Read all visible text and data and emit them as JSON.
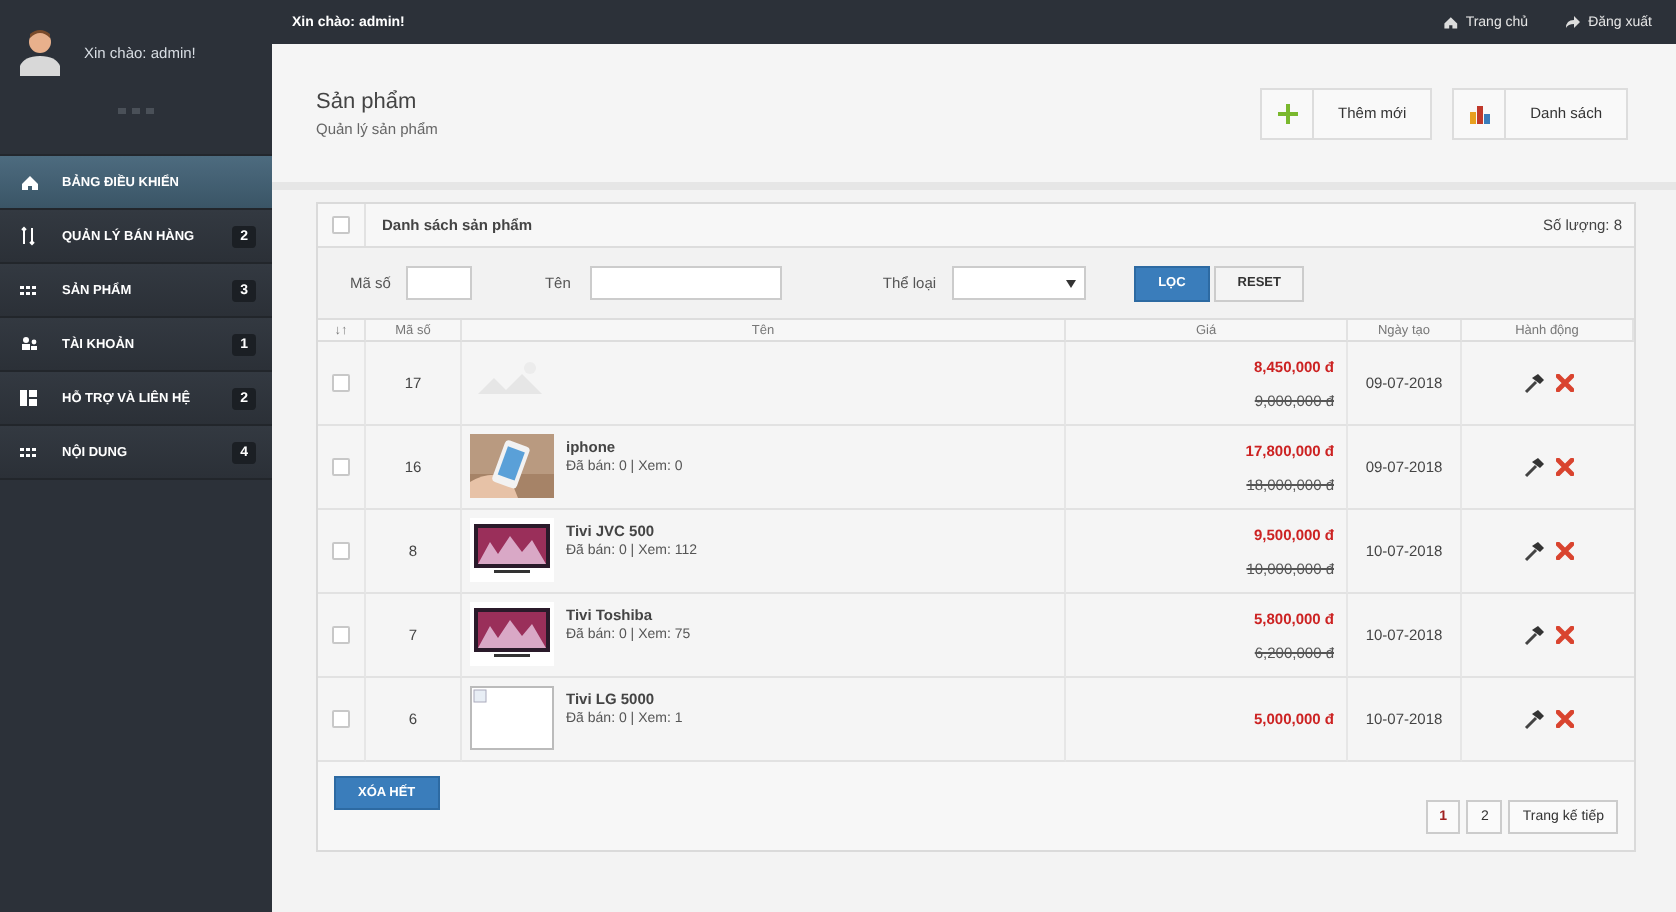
{
  "sidebar": {
    "greeting": "Xin chào: admin!",
    "items": [
      {
        "label": "BẢNG ĐIỀU KHIỂN",
        "kind": "home",
        "selected": true
      },
      {
        "label": "QUẢN LÝ BÁN HÀNG",
        "kind": "sort",
        "badge": "2",
        "selected": false
      },
      {
        "label": "SẢN PHẨM",
        "kind": "grid",
        "badge": "3",
        "selected": false
      },
      {
        "label": "TÀI KHOẢN",
        "kind": "users",
        "badge": "1",
        "selected": false
      },
      {
        "label": "HỖ TRỢ VÀ LIÊN HỆ",
        "kind": "layout",
        "badge": "2",
        "selected": false
      },
      {
        "label": "NỘI DUNG",
        "kind": "grid",
        "badge": "4",
        "selected": false
      }
    ]
  },
  "topbar": {
    "greeting": "Xin chào: admin!",
    "links": [
      {
        "label": "Trang chủ",
        "kind": "home"
      },
      {
        "label": "Đăng xuất",
        "kind": "exit"
      }
    ]
  },
  "header": {
    "title": "Sản phẩm",
    "subtitle": "Quản lý sản phẩm",
    "buttons": [
      {
        "label": "Thêm mới",
        "kind": "add"
      },
      {
        "label": "Danh sách",
        "kind": "list"
      }
    ]
  },
  "panel": {
    "title": "Danh sách sản phẩm",
    "count": "Số lượng: 8",
    "select_all_checked": false,
    "filters": {
      "code_label": "Mã số",
      "name_label": "Tên",
      "category_label": "Thể loại",
      "filter_button": "LỌC",
      "reset_button": "RESET"
    },
    "columns": [
      "↓↑",
      "Mã số",
      "Tên",
      "Giá",
      "Ngày tạo",
      "Hành động"
    ],
    "rows": [
      {
        "checked": false,
        "id": "17",
        "thumb": {
          "kind": "faint"
        },
        "price": "8,450,000 đ",
        "old_price": "9,000,000 đ",
        "date": "09-07-2018"
      },
      {
        "checked": false,
        "id": "16",
        "thumb": {
          "kind": "phone"
        },
        "name": "iphone",
        "stats": "Đã bán: 0 | Xem: 0",
        "price": "17,800,000 đ",
        "old_price": "18,000,000 đ",
        "date": "09-07-2018"
      },
      {
        "checked": false,
        "id": "8",
        "thumb": {
          "kind": "tv"
        },
        "name": "Tivi JVC 500",
        "stats": "Đã bán: 0 | Xem: 112",
        "price": "9,500,000 đ",
        "old_price": "10,000,000 đ",
        "date": "10-07-2018"
      },
      {
        "checked": false,
        "id": "7",
        "thumb": {
          "kind": "tv"
        },
        "name": "Tivi Toshiba",
        "stats": "Đã bán: 0 | Xem: 75",
        "price": "5,800,000 đ",
        "old_price": "6,200,000 đ",
        "date": "10-07-2018"
      },
      {
        "checked": false,
        "id": "6",
        "thumb": {
          "kind": "broken"
        },
        "name": "Tivi LG 5000",
        "stats": "Đã bán: 0 | Xem: 1",
        "price": "5,000,000 đ",
        "date": "10-07-2018"
      }
    ],
    "delete_all": "XÓA HẾT",
    "pages": [
      {
        "label": "1",
        "selected": true
      },
      {
        "label": "2",
        "selected": false
      },
      {
        "label": "Trang kế tiếp",
        "selected": false
      }
    ]
  }
}
